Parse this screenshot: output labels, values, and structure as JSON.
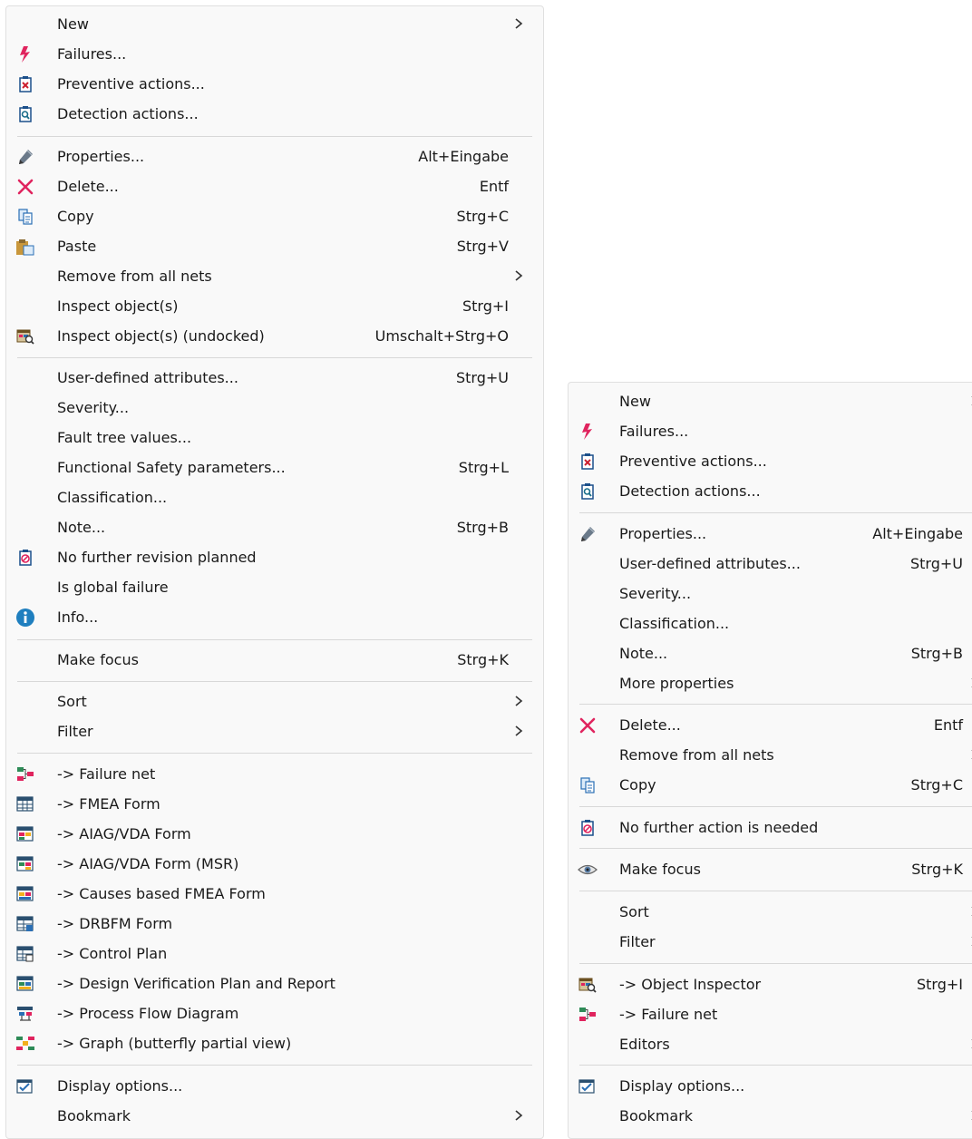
{
  "left_menu": {
    "items": [
      {
        "label": "New",
        "shortcut": "",
        "submenu": true,
        "icon": ""
      },
      {
        "label": "Failures...",
        "shortcut": "",
        "submenu": false,
        "icon": "lightning-icon"
      },
      {
        "label": "Preventive actions...",
        "shortcut": "",
        "submenu": false,
        "icon": "preventive-action-icon"
      },
      {
        "label": "Detection actions...",
        "shortcut": "",
        "submenu": false,
        "icon": "detection-action-icon"
      },
      {
        "label": "Properties...",
        "shortcut": "Alt+Eingabe",
        "submenu": false,
        "icon": "pencil-icon"
      },
      {
        "label": "Delete...",
        "shortcut": "Entf",
        "submenu": false,
        "icon": "delete-x-icon"
      },
      {
        "label": "Copy",
        "shortcut": "Strg+C",
        "submenu": false,
        "icon": "copy-icon"
      },
      {
        "label": "Paste",
        "shortcut": "Strg+V",
        "submenu": false,
        "icon": "paste-icon"
      },
      {
        "label": "Remove from all nets",
        "shortcut": "",
        "submenu": true,
        "icon": ""
      },
      {
        "label": "Inspect object(s)",
        "shortcut": "Strg+I",
        "submenu": false,
        "icon": ""
      },
      {
        "label": "Inspect object(s) (undocked)",
        "shortcut": "Umschalt+Strg+O",
        "submenu": false,
        "icon": "inspect-undocked-icon"
      },
      {
        "label": "User-defined attributes...",
        "shortcut": "Strg+U",
        "submenu": false,
        "icon": ""
      },
      {
        "label": "Severity...",
        "shortcut": "",
        "submenu": false,
        "icon": ""
      },
      {
        "label": "Fault tree values...",
        "shortcut": "",
        "submenu": false,
        "icon": ""
      },
      {
        "label": "Functional Safety parameters...",
        "shortcut": "Strg+L",
        "submenu": false,
        "icon": ""
      },
      {
        "label": "Classification...",
        "shortcut": "",
        "submenu": false,
        "icon": ""
      },
      {
        "label": "Note...",
        "shortcut": "Strg+B",
        "submenu": false,
        "icon": ""
      },
      {
        "label": "No further revision planned",
        "shortcut": "",
        "submenu": false,
        "icon": "no-revision-icon"
      },
      {
        "label": "Is global failure",
        "shortcut": "",
        "submenu": false,
        "icon": ""
      },
      {
        "label": "Info...",
        "shortcut": "",
        "submenu": false,
        "icon": "info-icon"
      },
      {
        "label": "Make focus",
        "shortcut": "Strg+K",
        "submenu": false,
        "icon": ""
      },
      {
        "label": "Sort",
        "shortcut": "",
        "submenu": true,
        "icon": ""
      },
      {
        "label": "Filter",
        "shortcut": "",
        "submenu": true,
        "icon": ""
      },
      {
        "label": "-> Failure net",
        "shortcut": "",
        "submenu": false,
        "icon": "failure-net-icon"
      },
      {
        "label": "-> FMEA Form",
        "shortcut": "",
        "submenu": false,
        "icon": "fmea-form-icon"
      },
      {
        "label": "-> AIAG/VDA Form",
        "shortcut": "",
        "submenu": false,
        "icon": "aiag-vda-form-icon"
      },
      {
        "label": "-> AIAG/VDA Form (MSR)",
        "shortcut": "",
        "submenu": false,
        "icon": "aiag-vda-msr-icon"
      },
      {
        "label": "-> Causes based FMEA Form",
        "shortcut": "",
        "submenu": false,
        "icon": "causes-fmea-icon"
      },
      {
        "label": "-> DRBFM Form",
        "shortcut": "",
        "submenu": false,
        "icon": "drbfm-form-icon"
      },
      {
        "label": "-> Control Plan",
        "shortcut": "",
        "submenu": false,
        "icon": "control-plan-icon"
      },
      {
        "label": "-> Design Verification Plan and Report",
        "shortcut": "",
        "submenu": false,
        "icon": "dvpr-icon"
      },
      {
        "label": "-> Process Flow Diagram",
        "shortcut": "",
        "submenu": false,
        "icon": "process-flow-icon"
      },
      {
        "label": "-> Graph (butterfly partial view)",
        "shortcut": "",
        "submenu": false,
        "icon": "butterfly-graph-icon"
      },
      {
        "label": "Display options...",
        "shortcut": "",
        "submenu": false,
        "icon": "display-options-icon"
      },
      {
        "label": "Bookmark",
        "shortcut": "",
        "submenu": true,
        "icon": ""
      }
    ]
  },
  "right_menu": {
    "items": [
      {
        "label": "New",
        "shortcut": "",
        "submenu": true,
        "icon": ""
      },
      {
        "label": "Failures...",
        "shortcut": "",
        "submenu": false,
        "icon": "lightning-icon"
      },
      {
        "label": "Preventive actions...",
        "shortcut": "",
        "submenu": false,
        "icon": "preventive-action-icon"
      },
      {
        "label": "Detection actions...",
        "shortcut": "",
        "submenu": false,
        "icon": "detection-action-icon"
      },
      {
        "label": "Properties...",
        "shortcut": "Alt+Eingabe",
        "submenu": false,
        "icon": "pencil-icon"
      },
      {
        "label": "User-defined attributes...",
        "shortcut": "Strg+U",
        "submenu": false,
        "icon": ""
      },
      {
        "label": "Severity...",
        "shortcut": "",
        "submenu": false,
        "icon": ""
      },
      {
        "label": "Classification...",
        "shortcut": "",
        "submenu": false,
        "icon": ""
      },
      {
        "label": "Note...",
        "shortcut": "Strg+B",
        "submenu": false,
        "icon": ""
      },
      {
        "label": "More properties",
        "shortcut": "",
        "submenu": true,
        "icon": ""
      },
      {
        "label": "Delete...",
        "shortcut": "Entf",
        "submenu": false,
        "icon": "delete-x-icon"
      },
      {
        "label": "Remove from all nets",
        "shortcut": "",
        "submenu": true,
        "icon": ""
      },
      {
        "label": "Copy",
        "shortcut": "Strg+C",
        "submenu": false,
        "icon": "copy-icon"
      },
      {
        "label": "No further action is needed",
        "shortcut": "",
        "submenu": false,
        "icon": "no-revision-icon"
      },
      {
        "label": "Make focus",
        "shortcut": "Strg+K",
        "submenu": false,
        "icon": "eye-icon"
      },
      {
        "label": "Sort",
        "shortcut": "",
        "submenu": true,
        "icon": ""
      },
      {
        "label": "Filter",
        "shortcut": "",
        "submenu": true,
        "icon": ""
      },
      {
        "label": "-> Object Inspector",
        "shortcut": "Strg+I",
        "submenu": false,
        "icon": "inspect-undocked-icon"
      },
      {
        "label": "-> Failure net",
        "shortcut": "",
        "submenu": false,
        "icon": "failure-net-icon"
      },
      {
        "label": "Editors",
        "shortcut": "",
        "submenu": true,
        "icon": ""
      },
      {
        "label": "Display options...",
        "shortcut": "",
        "submenu": false,
        "icon": "display-options-icon"
      },
      {
        "label": "Bookmark",
        "shortcut": "",
        "submenu": true,
        "icon": ""
      }
    ]
  }
}
